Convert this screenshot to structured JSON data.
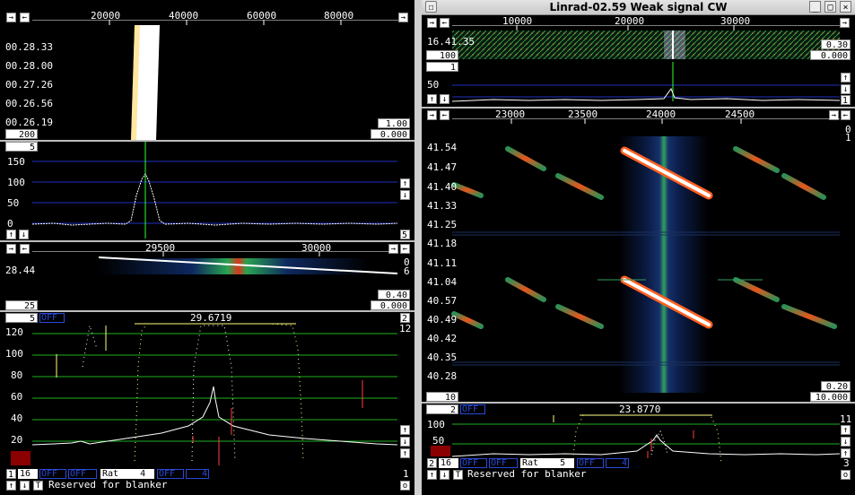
{
  "window": {
    "title": "Linrad-02.59 Weak signal CW"
  },
  "colors": {
    "grid_blue": "#2030c0",
    "grid_green": "#20b020",
    "trace": "#ffffff",
    "filter": "#ffff80",
    "marker_green": "#30ff30",
    "panel_sep": "#bdbdbd"
  },
  "left": {
    "wide_ruler_ticks": [
      "20000",
      "40000",
      "60000",
      "80000"
    ],
    "wide_times": [
      "00.28.33",
      "00.28.00",
      "00.27.26",
      "00.26.56",
      "00.26.19"
    ],
    "wide_gain": "1.00",
    "wide_avg": "200",
    "wide_zero": "0.000",
    "spec_avg": "5",
    "spec_levels": [
      "150",
      "100",
      "50",
      "0"
    ],
    "spec_corner": "5",
    "hires_ruler_ticks": [
      "29500",
      "30000"
    ],
    "hires_time": "28.44",
    "hires_right_top": "0",
    "hires_right_2": "6",
    "hires_gain": "0.40",
    "hires_avg": "25",
    "hires_zero": "0.000",
    "bfo_label": "5",
    "bfo_freq": "29.6719",
    "bfo_blue": "OFF",
    "bfo_num": "2",
    "bfo_right": "12",
    "bfo_levels": [
      "120",
      "100",
      "80",
      "60",
      "40",
      "20"
    ],
    "bottom_num": "1",
    "bottom_16": "16",
    "off_a": "OFF",
    "off_b": "OFF",
    "rat_label": "Rat",
    "rat_value": "4",
    "off_c": "OFF",
    "off_d": "4",
    "blanker_text": "Reserved for blanker",
    "bottom_right_1": "1",
    "bottom_right_o": "o"
  },
  "right": {
    "wide_ruler_ticks": [
      "10000",
      "20000",
      "30000"
    ],
    "wide_time": "16.41.35",
    "wide_gain": "0.30",
    "wide_avg": "100",
    "wide_zero": "0.000",
    "spec_avg": "1",
    "spec_level": "50",
    "spec_corner": "1",
    "hires_ruler_ticks": [
      "23000",
      "23500",
      "24000",
      "24500"
    ],
    "hires_times": [
      "41.54",
      "41.47",
      "41.40",
      "41.33",
      "41.25",
      "41.18",
      "41.11",
      "41.04",
      "40.57",
      "40.49",
      "40.42",
      "40.35",
      "40.28"
    ],
    "hires_right_top": "0",
    "hires_right_2": "1",
    "hires_gain": "0.20",
    "hires_avg": "10",
    "hires_zero": "10.000",
    "bfo_label": "2",
    "bfo_blue": "OFF",
    "bfo_freq": "23.8770",
    "bfo_right": "11",
    "bfo_levels": [
      "100",
      "50"
    ],
    "bottom_2": "2",
    "bottom_16": "16",
    "off_a": "OFF",
    "off_b": "OFF",
    "rat_label": "Rat",
    "rat_value": "5",
    "off_c": "OFF",
    "off_d": "4",
    "bottom_right_3": "3",
    "blanker_text": "Reserved for blanker",
    "bottom_right_o": "o"
  }
}
